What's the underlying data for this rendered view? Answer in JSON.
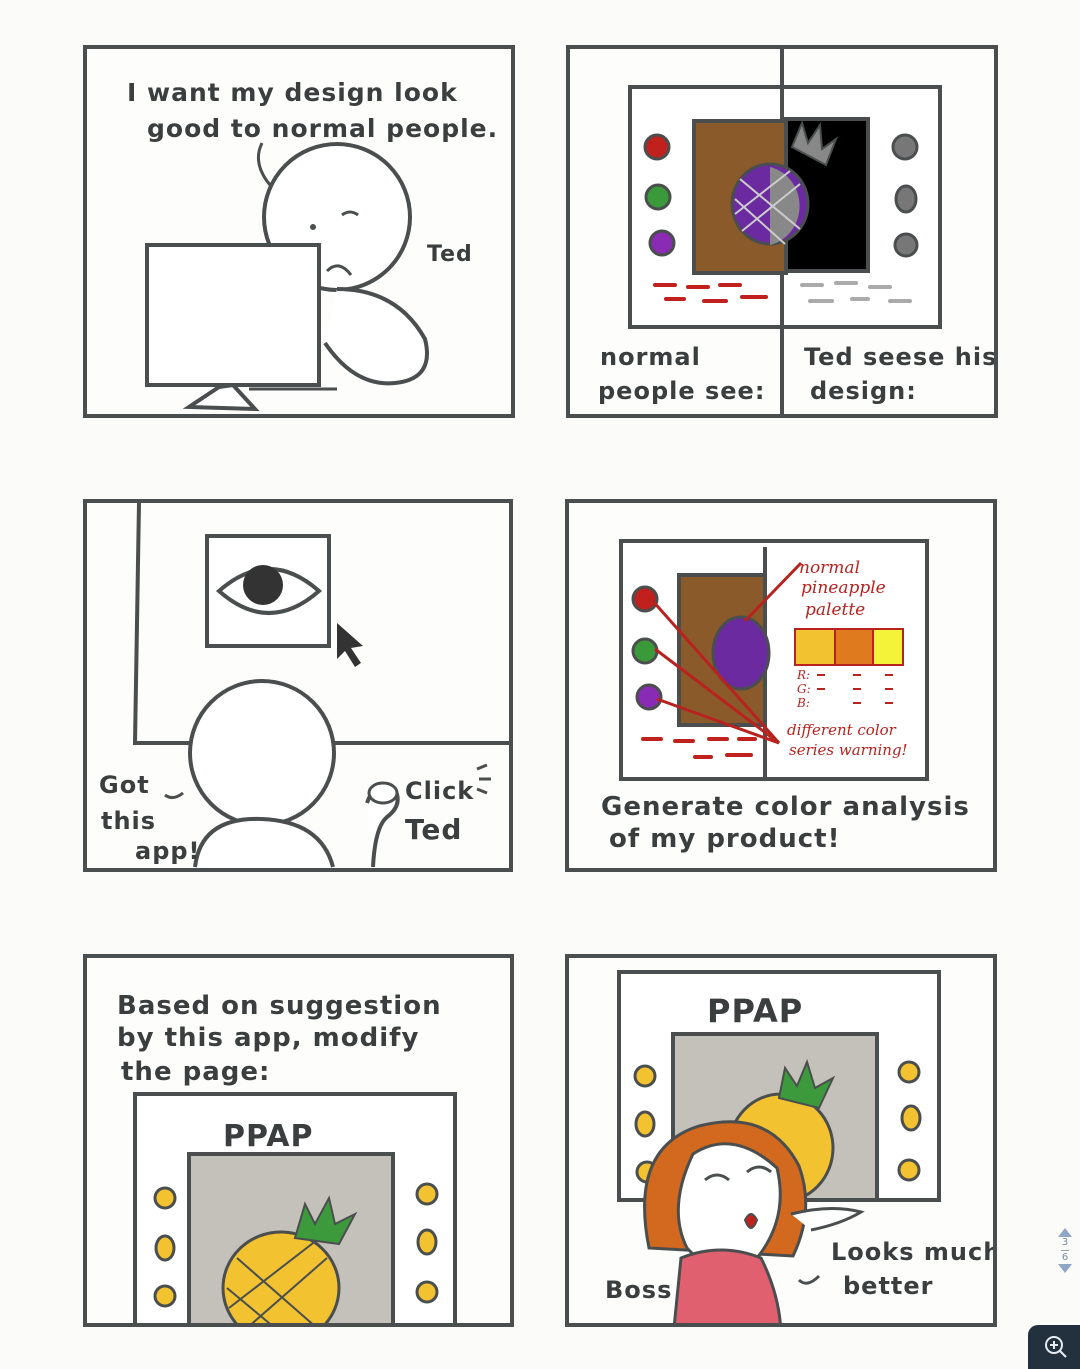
{
  "panels": {
    "p1": {
      "caption_line1": "I want my design look",
      "caption_line2": "good to normal people.",
      "name_label": "Ted"
    },
    "p2": {
      "left_label_line1": "normal",
      "left_label_line2": "people see:",
      "right_label_line1": "Ted seese his",
      "right_label_line2": "design:"
    },
    "p3": {
      "got_line1": "Got",
      "got_line2": "this",
      "got_line3": "app!",
      "click_label": "Click",
      "name_label": "Ted"
    },
    "p4": {
      "note_line1": "normal",
      "note_line2": "pineapple",
      "note_line3": "palette",
      "rgb_r": "R:",
      "rgb_g": "G:",
      "rgb_b": "B:",
      "warn_line1": "different color",
      "warn_line2": "series warning!",
      "caption_line1": "Generate color analysis",
      "caption_line2": "of my product!"
    },
    "p5": {
      "caption_line1": "Based on suggestion",
      "caption_line2": "by this app, modify",
      "caption_line3": "the page:",
      "screen_title": "PPAP"
    },
    "p6": {
      "screen_title": "PPAP",
      "boss_label": "Boss",
      "quote_line1": "Looks much",
      "quote_line2": "better"
    }
  },
  "pager": {
    "current": "3",
    "total": "6"
  },
  "colors": {
    "outline": "#4a4e4e",
    "red": "#c0211d",
    "green": "#3a9a3a",
    "purple": "#8a2bb5",
    "brown": "#8a5a2b",
    "pineapple_yellow": "#f2c230",
    "leaf_green": "#3c9a3c",
    "hair_orange": "#d2691e",
    "shirt_pink": "#e06070",
    "screen_gray": "#c4c1bb"
  },
  "icons": {
    "pager_up": "triangle-up-icon",
    "pager_down": "triangle-down-icon",
    "zoom": "zoom-in-icon"
  }
}
